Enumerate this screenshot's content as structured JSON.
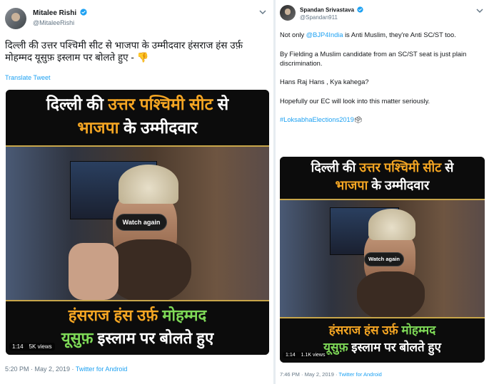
{
  "tweet_left": {
    "author_name": "Mitalee Rishi",
    "handle": "@MitaleeRishi",
    "text": "दिल्ली की उत्तर पश्चिमी सीट से भाजपा के उम्मीदवार हंसराज हंस उर्फ़ मोहम्मद यूसुफ़ इस्लाम पर बोलते हुए - 👎",
    "translate_label": "Translate Tweet",
    "video": {
      "banner_line1_a": "दिल्ली की ",
      "banner_line1_b": "उत्तर पश्चिमी सीट",
      "banner_line1_c": " से",
      "banner_line2_a": "भाजपा",
      "banner_line2_b": " के उम्मीदवार",
      "bottom_line1_a": "हंसराज हंस उर्फ़ ",
      "bottom_line1_b": "मोहम्मद",
      "bottom_line2_a": "यूसुफ़",
      "bottom_line2_b": " इस्लाम पर बोलते हुए",
      "watch_again": "Watch again",
      "duration": "1:14",
      "views": "5K views"
    },
    "timestamp": "5:20 PM · May 2, 2019 · ",
    "source": "Twitter for Android"
  },
  "tweet_right": {
    "author_name": "Spandan Srivastava",
    "handle": "@Spandan911",
    "p1_a": "Not only ",
    "p1_mention": "@BJP4India",
    "p1_b": " is Anti Muslim, they're Anti SC/ST too.",
    "p2": "By Fielding a Muslim candidate from an SC/ST seat is just plain discrimination.",
    "p3": "Hans Raj Hans , Kya kahega?",
    "p4": "Hopefully our EC will look into this matter seriously.",
    "hashtag": "#LoksabhaElections2019",
    "hashtag_emoji": "🗳",
    "video": {
      "banner_line1_a": "दिल्ली की ",
      "banner_line1_b": "उत्तर पश्चिमी सीट",
      "banner_line1_c": " से",
      "banner_line2_a": "भाजपा",
      "banner_line2_b": " के उम्मीदवार",
      "bottom_line1_a": "हंसराज हंस उर्फ़ ",
      "bottom_line1_b": "मोहम्मद",
      "bottom_line2_a": "यूसुफ़",
      "bottom_line2_b": " इस्लाम पर बोलते हुए",
      "watch_again": "Watch again",
      "duration": "1:14",
      "views": "1.1K views"
    },
    "timestamp": "7:46 PM · May 2, 2019 · ",
    "source": "Twitter for Android"
  },
  "colors": {
    "link": "#1da1f2",
    "banner_orange": "#f5a623",
    "banner_green": "#7ed957",
    "gold_rule": "#c8a64a"
  },
  "icons": [
    "verified-badge-icon",
    "chevron-down-icon"
  ]
}
